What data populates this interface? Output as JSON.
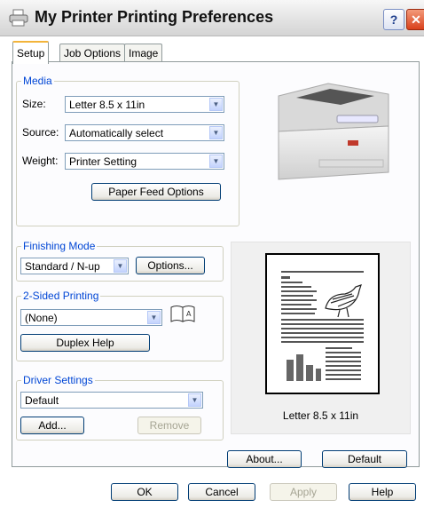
{
  "window": {
    "title": "My Printer Printing Preferences",
    "help_glyph": "?",
    "close_glyph": "✕"
  },
  "tabs": [
    "Setup",
    "Job Options",
    "Image"
  ],
  "media": {
    "legend": "Media",
    "size_label": "Size:",
    "size_value": "Letter 8.5 x 11in",
    "source_label": "Source:",
    "source_value": "Automatically select",
    "weight_label": "Weight:",
    "weight_value": "Printer Setting",
    "paper_feed_button": "Paper Feed Options"
  },
  "finishing": {
    "legend": "Finishing Mode",
    "mode_value": "Standard / N-up",
    "options_button": "Options..."
  },
  "two_sided": {
    "legend": "2-Sided Printing",
    "value": "(None)",
    "duplex_help_button": "Duplex Help"
  },
  "driver": {
    "legend": "Driver Settings",
    "value": "Default",
    "add_button": "Add...",
    "remove_button": "Remove"
  },
  "preview": {
    "caption": "Letter 8.5 x 11in"
  },
  "about_button": "About...",
  "default_button": "Default",
  "footer": {
    "ok": "OK",
    "cancel": "Cancel",
    "apply": "Apply",
    "help": "Help"
  },
  "icons": [
    "printer-icon",
    "help-icon",
    "close-icon",
    "chevron-down-icon",
    "booklet-icon",
    "printer-image",
    "page-preview-image"
  ],
  "colors": {
    "legend_text": "#0046d5",
    "tab_accent": "#f3b43a",
    "button_border": "#003c74",
    "close_red": "#d9411c"
  }
}
